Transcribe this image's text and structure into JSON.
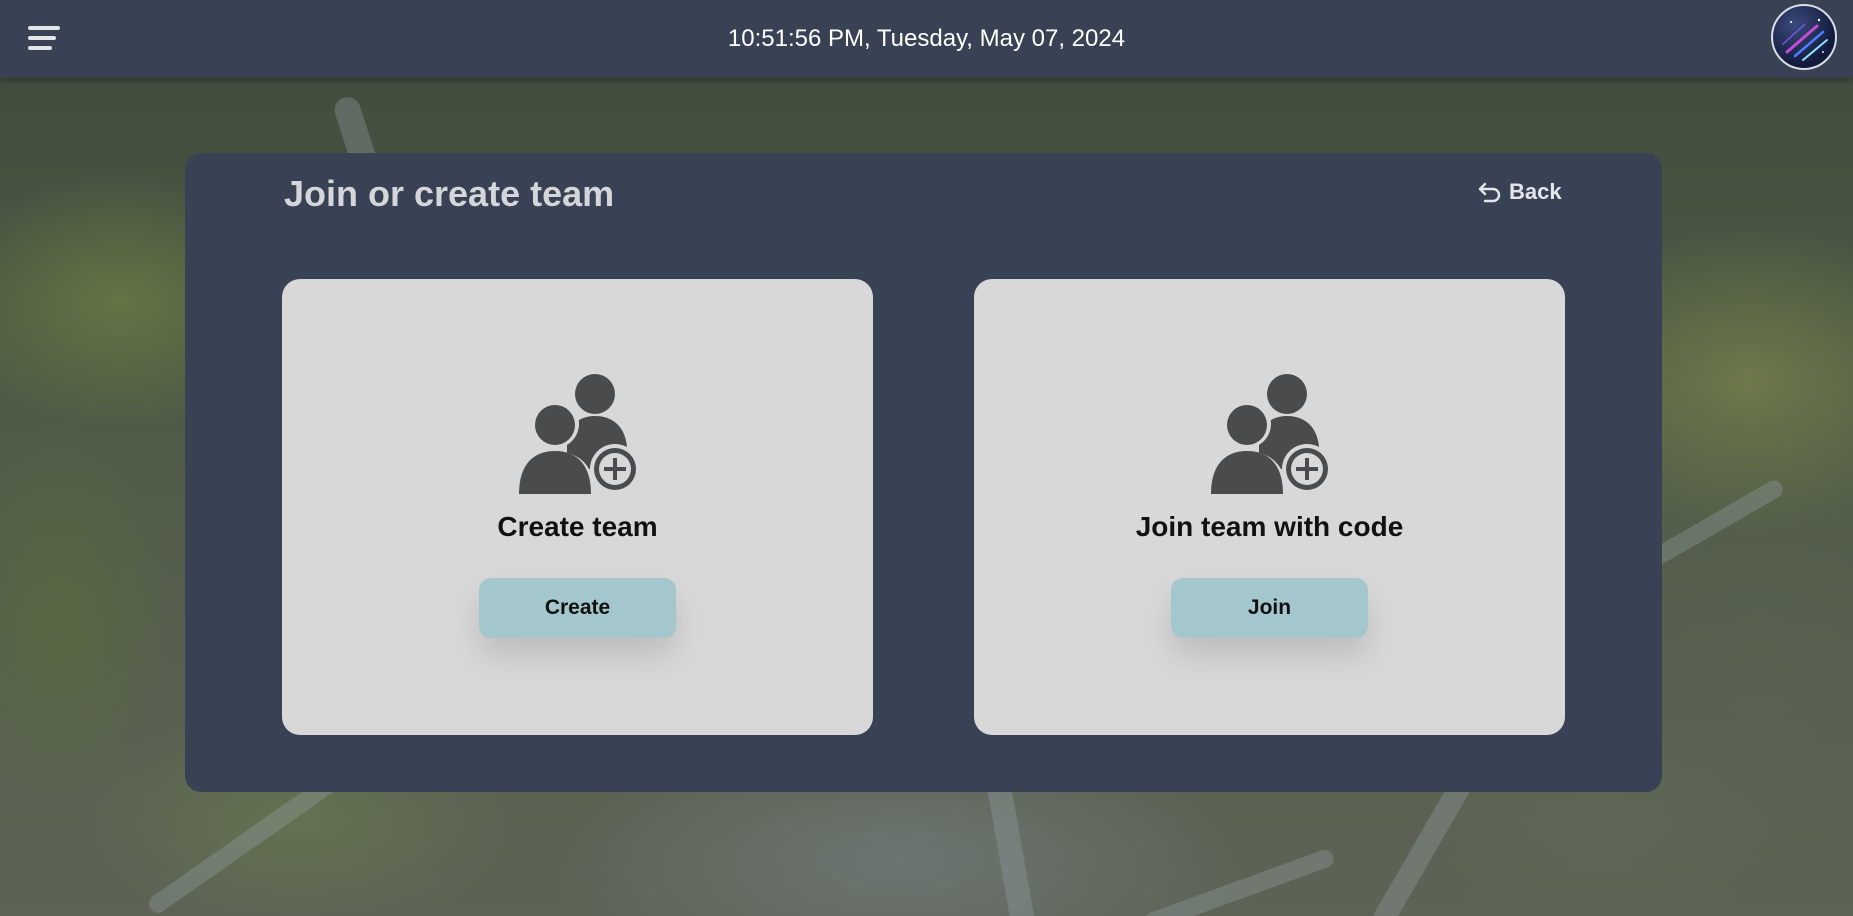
{
  "topbar": {
    "datetime": "10:51:56 PM, Tuesday, May 07, 2024",
    "menu_icon": "hamburger-menu-icon",
    "avatar_icon": "user-avatar"
  },
  "panel": {
    "title": "Join or create team",
    "back_label": "Back",
    "back_icon": "undo-arrow-icon"
  },
  "cards": [
    {
      "icon": "add-group-icon",
      "title": "Create team",
      "button_label": "Create"
    },
    {
      "icon": "add-group-icon",
      "title": "Join team with code",
      "button_label": "Join"
    }
  ],
  "colors": {
    "header_bg": "#384254",
    "panel_bg": "#384254",
    "card_bg": "#d8d8d8",
    "button_bg": "#a3c7cc",
    "icon": "#4a4b4d"
  }
}
